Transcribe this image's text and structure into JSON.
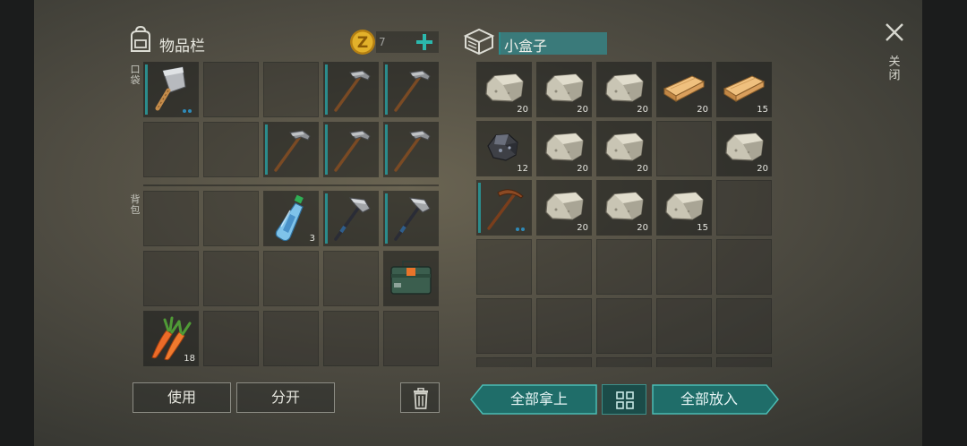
{
  "inventory": {
    "title": "物品栏",
    "coin_count": "7",
    "pocket_label": "口袋",
    "backpack_label": "背包",
    "pocket_slots": [
      {
        "item": "cleaver",
        "count": "",
        "bar": true,
        "dots": true
      },
      {
        "item": null
      },
      {
        "item": null
      },
      {
        "item": "stone-hammer",
        "count": "",
        "bar": true
      },
      {
        "item": "stone-hammer",
        "count": "",
        "bar": true
      },
      {
        "item": null
      },
      {
        "item": null
      },
      {
        "item": "stone-hammer",
        "count": "",
        "bar": true
      },
      {
        "item": "stone-hammer",
        "count": "",
        "bar": true
      },
      {
        "item": "stone-hammer",
        "count": "",
        "bar": true
      }
    ],
    "backpack_slots": [
      {
        "item": null
      },
      {
        "item": null
      },
      {
        "item": "water-bottle",
        "count": "3"
      },
      {
        "item": "stone-hatchet",
        "count": "",
        "bar": true
      },
      {
        "item": "stone-hatchet",
        "count": "",
        "bar": true
      },
      {
        "item": null
      },
      {
        "item": null
      },
      {
        "item": null
      },
      {
        "item": null
      },
      {
        "item": "crafting-kit",
        "count": ""
      },
      {
        "item": "carrot",
        "count": "18"
      },
      {
        "item": null
      },
      {
        "item": null
      },
      {
        "item": null
      },
      {
        "item": null
      }
    ],
    "use_label": "使用",
    "split_label": "分开"
  },
  "container": {
    "title": "小盒子",
    "slots": [
      {
        "item": "stone",
        "count": "20"
      },
      {
        "item": "stone",
        "count": "20"
      },
      {
        "item": "stone",
        "count": "20"
      },
      {
        "item": "wood-plank",
        "count": "20"
      },
      {
        "item": "wood-plank",
        "count": "15"
      },
      {
        "item": "iron-ore",
        "count": "12"
      },
      {
        "item": "stone",
        "count": "20"
      },
      {
        "item": "stone",
        "count": "20"
      },
      {
        "item": null
      },
      {
        "item": "stone",
        "count": "20"
      },
      {
        "item": "pickaxe",
        "count": "",
        "bar": true,
        "dots": true
      },
      {
        "item": "stone",
        "count": "20"
      },
      {
        "item": "stone",
        "count": "20"
      },
      {
        "item": "stone",
        "count": "15"
      },
      {
        "item": null
      },
      {
        "item": null
      },
      {
        "item": null
      },
      {
        "item": null
      },
      {
        "item": null
      },
      {
        "item": null
      },
      {
        "item": null
      },
      {
        "item": null
      },
      {
        "item": null
      },
      {
        "item": null
      },
      {
        "item": null
      },
      {
        "item": null
      },
      {
        "item": null
      },
      {
        "item": null
      },
      {
        "item": null
      },
      {
        "item": null
      }
    ],
    "take_all_label": "全部拿上",
    "put_all_label": "全部放入"
  },
  "close_label": "关闭",
  "icons": {
    "backpack": "backpack-icon",
    "coin": "coin-icon",
    "plus": "plus-icon",
    "box": "box-icon",
    "trash": "trash-icon",
    "sort": "sort-icon",
    "close": "close-icon"
  },
  "colors": {
    "accent_teal": "#2b8c8c",
    "teal_button": "#1f6d69",
    "coin_gold": "#e3b12a",
    "durability_dots": "#2f8ab8"
  }
}
